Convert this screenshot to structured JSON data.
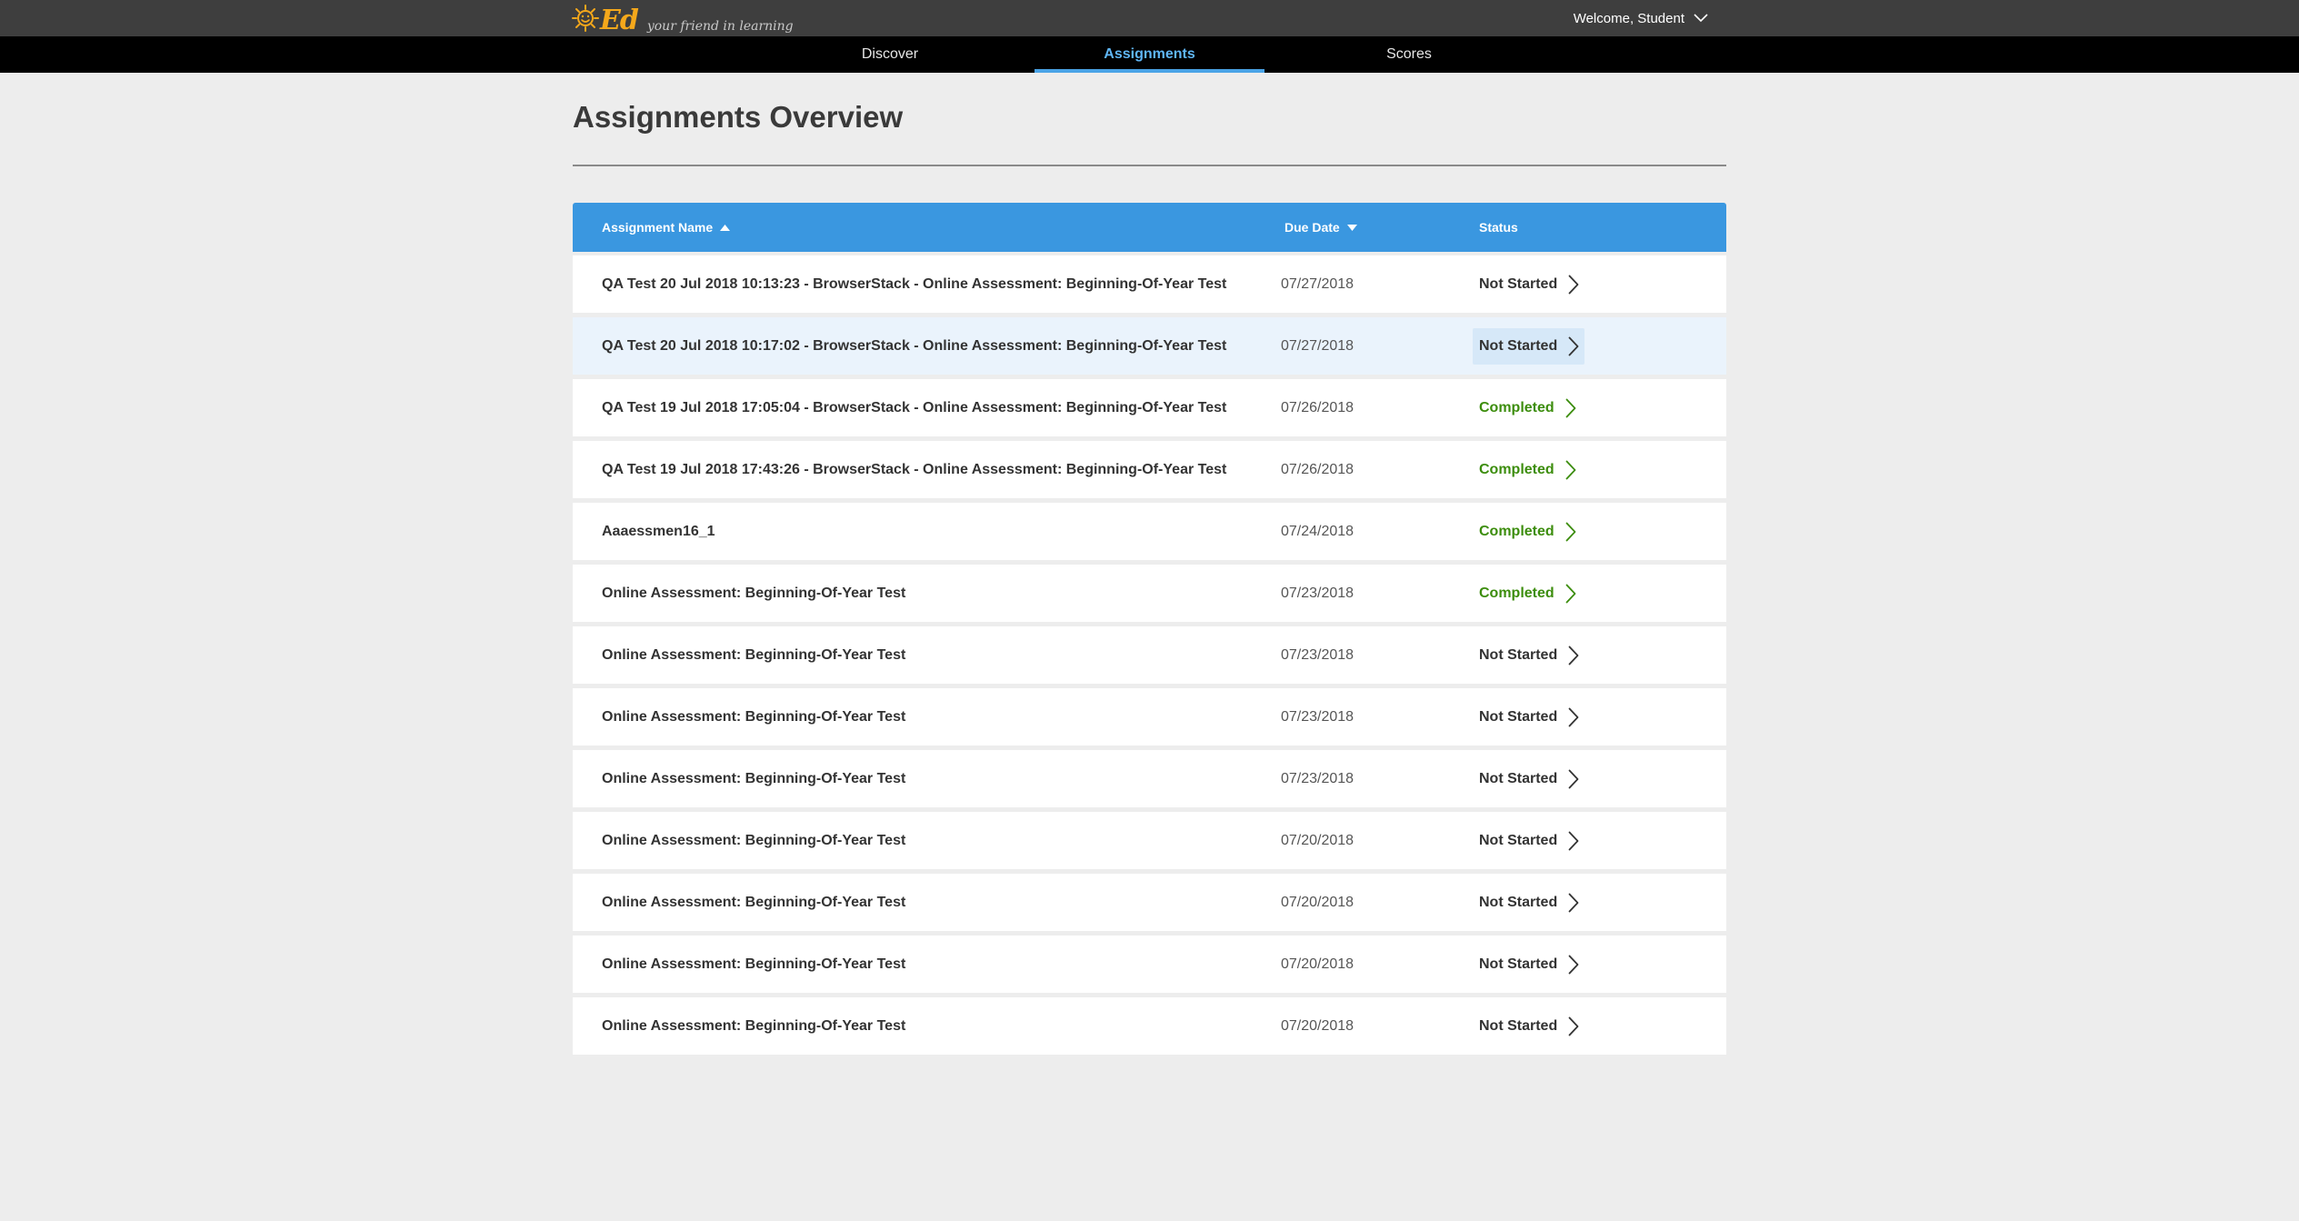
{
  "header": {
    "logo_text": "Ed",
    "tagline": "your friend in learning",
    "welcome": "Welcome, Student"
  },
  "nav": {
    "tabs": [
      {
        "label": "Discover",
        "active": false
      },
      {
        "label": "Assignments",
        "active": true
      },
      {
        "label": "Scores",
        "active": false
      }
    ]
  },
  "page": {
    "title": "Assignments Overview"
  },
  "table": {
    "columns": {
      "name": "Assignment Name",
      "due": "Due Date",
      "status": "Status"
    },
    "rows": [
      {
        "name": "QA Test 20 Jul 2018 10:13:23 - BrowserStack - Online Assessment: Beginning-Of-Year Test",
        "due": "07/27/2018",
        "status": "Not Started"
      },
      {
        "name": "QA Test 20 Jul 2018 10:17:02 - BrowserStack - Online Assessment: Beginning-Of-Year Test",
        "due": "07/27/2018",
        "status": "Not Started"
      },
      {
        "name": "QA Test 19 Jul 2018 17:05:04 - BrowserStack - Online Assessment: Beginning-Of-Year Test",
        "due": "07/26/2018",
        "status": "Completed"
      },
      {
        "name": "QA Test 19 Jul 2018 17:43:26 - BrowserStack - Online Assessment: Beginning-Of-Year Test",
        "due": "07/26/2018",
        "status": "Completed"
      },
      {
        "name": "Aaaessmen16_1",
        "due": "07/24/2018",
        "status": "Completed"
      },
      {
        "name": "Online Assessment: Beginning-Of-Year Test",
        "due": "07/23/2018",
        "status": "Completed"
      },
      {
        "name": "Online Assessment: Beginning-Of-Year Test",
        "due": "07/23/2018",
        "status": "Not Started"
      },
      {
        "name": "Online Assessment: Beginning-Of-Year Test",
        "due": "07/23/2018",
        "status": "Not Started"
      },
      {
        "name": "Online Assessment: Beginning-Of-Year Test",
        "due": "07/23/2018",
        "status": "Not Started"
      },
      {
        "name": "Online Assessment: Beginning-Of-Year Test",
        "due": "07/20/2018",
        "status": "Not Started"
      },
      {
        "name": "Online Assessment: Beginning-Of-Year Test",
        "due": "07/20/2018",
        "status": "Not Started"
      },
      {
        "name": "Online Assessment: Beginning-Of-Year Test",
        "due": "07/20/2018",
        "status": "Not Started"
      },
      {
        "name": "Online Assessment: Beginning-Of-Year Test",
        "due": "07/20/2018",
        "status": "Not Started"
      }
    ]
  },
  "colors": {
    "header_bg": "#3e3e3e",
    "nav_bg": "#000000",
    "accent": "#3a97e0",
    "active_tab": "#5fb6f5",
    "completed": "#3c8d0d",
    "logo": "#f5a81b",
    "page_bg": "#ededed"
  },
  "icons": {
    "logo": "sun-face-icon",
    "welcome_menu": "chevron-down-icon",
    "sort_name": "sort-ascending-icon",
    "sort_due": "sort-descending-icon",
    "row_action": "chevron-right-icon"
  }
}
